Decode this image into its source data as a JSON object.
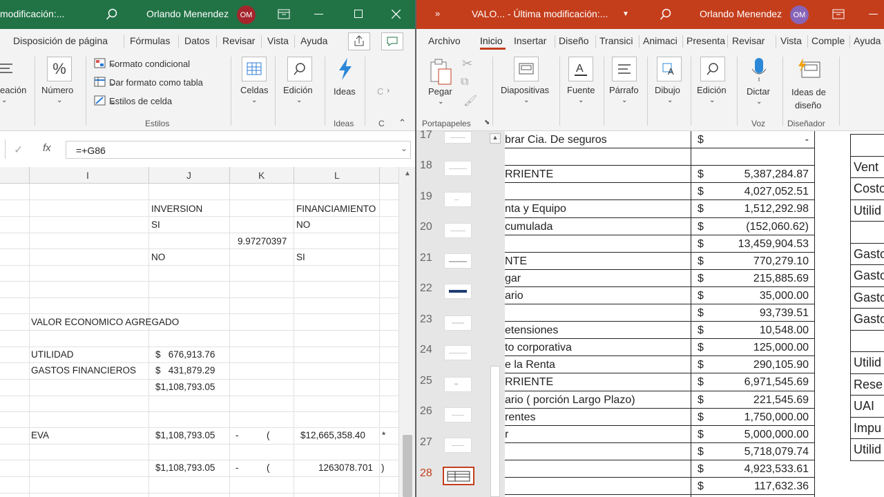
{
  "excel": {
    "title": "modificación:...",
    "user": "Orlando Menendez",
    "initials": "OM",
    "tabs": [
      "Disposición de página",
      "Fórmulas",
      "Datos",
      "Revisar",
      "Vista",
      "Ayuda"
    ],
    "ribbon": {
      "alineacion": "eación",
      "numero": "Número",
      "formato_condicional": "Formato condicional",
      "dar_formato_tabla": "Dar formato como tabla",
      "estilos_celda": "Estilos de celda",
      "estilos_group": "Estilos",
      "celdas": "Celdas",
      "edicion": "Edición",
      "ideas": "Ideas",
      "ideas_group": "Ideas",
      "c_group": "C",
      "c_button": "C"
    },
    "formula": "=+G86",
    "fx": "fx",
    "columns": [
      "I",
      "J",
      "K",
      "L"
    ],
    "cells": {
      "inversion": "INVERSION",
      "financiamiento": "FINANCIAMIENTO",
      "si1": "SI",
      "no1": "NO",
      "k_value": "9.97270397",
      "no2": "NO",
      "si2": "SI",
      "vea": "VALOR ECONOMICO AGREGADO",
      "utilidad": "UTILIDAD",
      "utilidad_val": "$   676,913.76",
      "gastos": "GASTOS FINANCIEROS",
      "gastos_val": "$   431,879.29",
      "sum1": "$1,108,793.05",
      "eva": "EVA",
      "eva_val": "$1,108,793.05",
      "dash1": "-",
      "paren1": "(",
      "l_val1": "$12,665,358.40",
      "star": "*",
      "eva_val2": "$1,108,793.05",
      "dash2": "-",
      "paren2": "(",
      "l_val2": "1263078.701",
      "close_paren": ")"
    }
  },
  "ppt": {
    "title": "VALO...  -  Última modificación:...",
    "user": "Orlando Menendez",
    "initials": "OM",
    "tabs": [
      "Archivo",
      "Inicio",
      "Insertar",
      "Diseño",
      "Transici",
      "Animaci",
      "Presenta",
      "Revisar",
      "Vista",
      "Comple",
      "Ayuda"
    ],
    "ribbon": {
      "pegar": "Pegar",
      "portapapeles": "Portapapeles",
      "diapositivas": "Diapositivas",
      "fuente": "Fuente",
      "parrafo": "Párrafo",
      "dibujo": "Dibujo",
      "edicion": "Edición",
      "dictar": "Dictar",
      "voz": "Voz",
      "ideas1": "Ideas de",
      "ideas2": "diseño",
      "disenador": "Diseñador"
    },
    "slide_numbers": [
      "17",
      "18",
      "19",
      "20",
      "21",
      "22",
      "23",
      "24",
      "25",
      "26",
      "27",
      "28"
    ],
    "rows": [
      {
        "label": "brar Cia. De seguros",
        "cur": "$",
        "amount": "-"
      },
      {
        "label": "",
        "cur": "",
        "amount": ""
      },
      {
        "label": "RRIENTE",
        "cur": "$",
        "amount": "5,387,284.87"
      },
      {
        "label": "",
        "cur": "$",
        "amount": "4,027,052.51"
      },
      {
        "label": "nta y Equipo",
        "cur": "$",
        "amount": "1,512,292.98"
      },
      {
        "label": "cumulada",
        "cur": "$",
        "amount": "(152,060.62)"
      },
      {
        "label": "",
        "cur": "$",
        "amount": "13,459,904.53"
      },
      {
        "label": "NTE",
        "cur": "$",
        "amount": "770,279.10"
      },
      {
        "label": "gar",
        "cur": "$",
        "amount": "215,885.69"
      },
      {
        "label": "ario",
        "cur": "$",
        "amount": "35,000.00"
      },
      {
        "label": "",
        "cur": "$",
        "amount": "93,739.51"
      },
      {
        "label": "etensiones",
        "cur": "$",
        "amount": "10,548.00"
      },
      {
        "label": "to corporativa",
        "cur": "$",
        "amount": "125,000.00"
      },
      {
        "label": "e la Renta",
        "cur": "$",
        "amount": "290,105.90"
      },
      {
        "label": "RRIENTE",
        "cur": "$",
        "amount": "6,971,545.69"
      },
      {
        "label": "ario ( porción Largo Plazo)",
        "cur": "$",
        "amount": "221,545.69"
      },
      {
        "label": "rentes",
        "cur": "$",
        "amount": "1,750,000.00"
      },
      {
        "label": "r",
        "cur": "$",
        "amount": "5,000,000.00"
      },
      {
        "label": "",
        "cur": "$",
        "amount": "5,718,079.74"
      },
      {
        "label": "",
        "cur": "$",
        "amount": "4,923,533.61"
      },
      {
        "label": "",
        "cur": "$",
        "amount": "117,632.36"
      }
    ],
    "right_labels": [
      "",
      "Vent",
      "Costo",
      "Utilid",
      "",
      "Gasto",
      "Gasto",
      "Gasto",
      "Gasto",
      "",
      "Utilid",
      "Rese",
      "UAI",
      "Impu",
      "Utilid"
    ]
  },
  "colors": {
    "excel_green": "#217346",
    "ppt_orange": "#c43e1c",
    "avatar_excel": "#a4262c",
    "avatar_ppt": "#8764b8"
  }
}
